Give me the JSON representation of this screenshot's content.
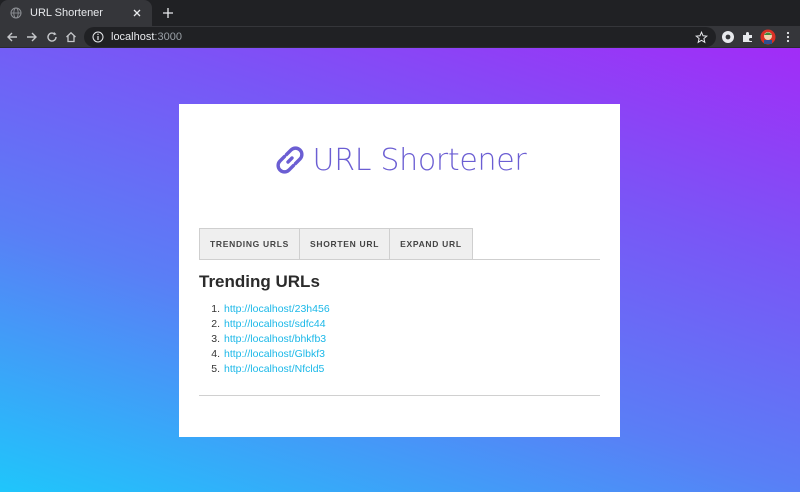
{
  "browser": {
    "tab_title": "URL Shortener",
    "url_host": "localhost",
    "url_port": ":3000"
  },
  "app": {
    "brand_title": "URL Shortener",
    "brand_color": "#6b5ed3",
    "link_color": "#1bb8e8",
    "tabs": [
      {
        "label": "TRENDING URLS"
      },
      {
        "label": "SHORTEN URL"
      },
      {
        "label": "EXPAND URL"
      }
    ],
    "section_title": "Trending URLs",
    "trending": [
      {
        "num": "1.",
        "url": "http://localhost/23h456"
      },
      {
        "num": "2.",
        "url": "http://localhost/sdfc44"
      },
      {
        "num": "3.",
        "url": "http://localhost/bhkfb3"
      },
      {
        "num": "4.",
        "url": "http://localhost/Glbkf3"
      },
      {
        "num": "5.",
        "url": "http://localhost/Nfcld5"
      }
    ]
  },
  "icons": [
    "globe-icon",
    "close-icon",
    "plus-icon",
    "back-arrow-icon",
    "forward-arrow-icon",
    "reload-icon",
    "home-icon",
    "info-icon",
    "star-icon",
    "record-icon",
    "puzzle-icon",
    "avatar",
    "kebab-menu-icon",
    "link-icon"
  ]
}
